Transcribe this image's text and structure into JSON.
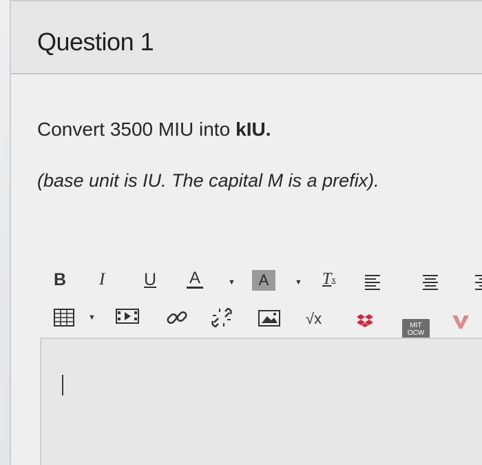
{
  "question": {
    "title": "Question 1",
    "line1_text": "Convert 3500 MIU into",
    "line1_bold": "kIU.",
    "line2": "(base unit is IU. The capital M is a prefix)."
  },
  "toolbar": {
    "row1": [
      {
        "name": "bold-button",
        "label": "B"
      },
      {
        "name": "italic-button",
        "label": "I"
      },
      {
        "name": "underline-button",
        "label": "U"
      },
      {
        "name": "font-color-button",
        "label": "A"
      },
      {
        "name": "background-color-button",
        "label": "A"
      },
      {
        "name": "remove-format-button",
        "label": "T",
        "sub": "x"
      }
    ],
    "sqrt_label": "√x",
    "mit_label_top": "MIT",
    "mit_label_bottom": "OCW",
    "icons": [
      "align-left-icon",
      "align-center-icon",
      "align-right-icon",
      "table-icon",
      "media-icon",
      "link-icon",
      "unlink-icon",
      "image-icon",
      "dropbox-icon",
      "mit-ocw-icon",
      "v-mark-icon"
    ]
  },
  "colors": {
    "header_bg": "#e6e6e6",
    "panel_bg": "#efefef",
    "text": "#262626",
    "dropbox": "#d9233e",
    "v_mark": "#d98a8a"
  }
}
